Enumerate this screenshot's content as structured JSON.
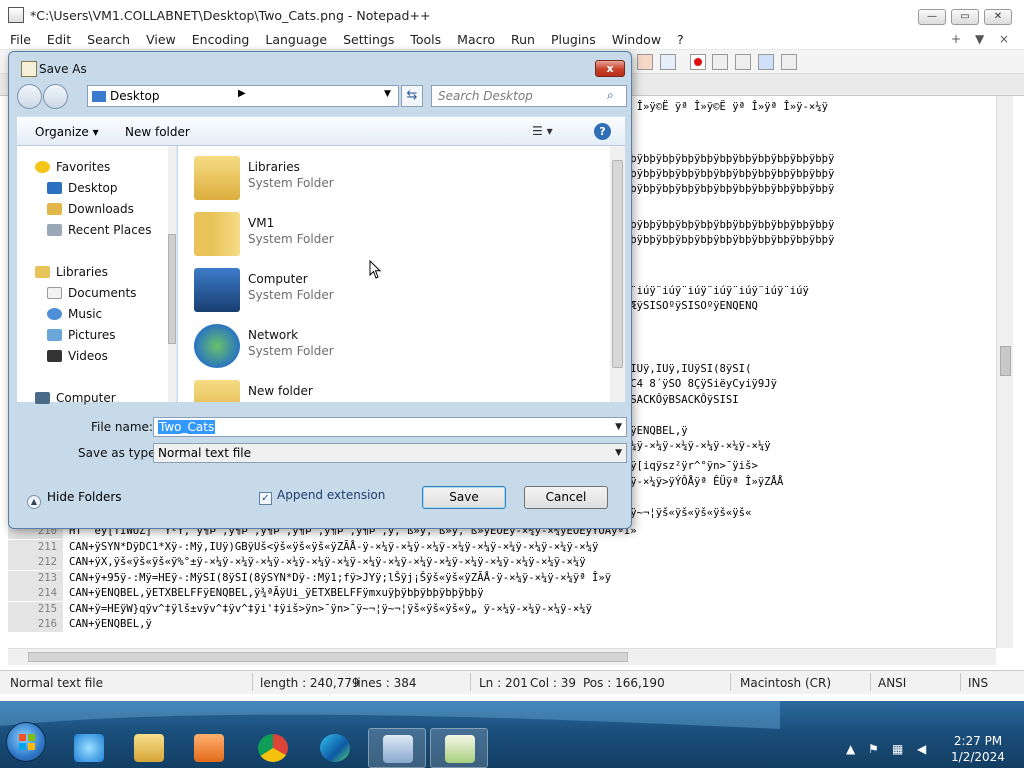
{
  "npp": {
    "title": "*C:\\Users\\VM1.COLLABNET\\Desktop\\Two_Cats.png - Notepad++",
    "menu": [
      "File",
      "Edit",
      "Search",
      "View",
      "Encoding",
      "Language",
      "Settings",
      "Tools",
      "Macro",
      "Run",
      "Plugins",
      "Window",
      "?"
    ],
    "menu_right": [
      "+",
      "▼",
      "×"
    ],
    "editor_lines": [
      {
        "num": "",
        "text": "                                                                ÿ©Ë ÿª Î»ÿ©Ë ÿª Î»ÿ©Ë ÿª Î»ÿ©Ë ÿª Î»ÿ©Ë ÿª Î»ÿª Î»ÿ-×¼ÿ"
      },
      {
        "num": "",
        "text": "                                                                þÿbþÿbþÿbþÿbþÿbþÿbþÿbþÿbþÿbþÿbþÿbþÿbþÿbþÿbþÿbþÿbþÿbþÿbþÿ"
      },
      {
        "num": "",
        "text": "                                                                þÿbþÿbþÿbþÿbþÿbþÿbþÿbþÿbþÿbþÿbþÿbþÿbþÿbþÿbþÿbþÿbþÿbþÿbþÿ"
      },
      {
        "num": "",
        "text": "                                                                þÿbþÿbþÿbþÿbþÿbþÿbþÿbþÿbþÿbþÿbþÿbþÿbþÿbþÿbþÿbþÿbþÿbþÿbþÿ"
      },
      {
        "num": "",
        "text": "                                                                þÿbþÿbþÿbþÿbþÿbþÿbþÿbþÿbþÿbþÿbþÿbþÿbþÿbþÿbþÿbþÿbþÿbþÿbþÿ"
      },
      {
        "num": "",
        "text": "                                                                þÿbþÿbþÿbþÿbþÿbþÿbþÿbþÿbþÿbþÿbþÿbþÿbþÿbþÿbþÿbþÿbþÿbþÿbþÿ"
      },
      {
        "num": "",
        "text": "                                                                ¨iúÿ¨iúÿ¨iúÿ¨iúÿ¨iúÿ¨iúÿ¨iúÿ¨iúÿ¨iúÿ¨iúÿ¨iúÿ¨iúÿ¨iúÿ"
      },
      {
        "num": "",
        "text": "                                                                Siëyj‡ÇÿyŒÔÿ\\yØÿKdÛÿETB,ÆÿSISOºÿSISOºÿENQENQ"
      },
      {
        "num": "",
        "text": "                                                                JYÿ=HEÿ-:Mÿ=HEÿ>JYÿ>JYÿ,IUÿ,IUÿ,IUÿSI(8ÿSI("
      },
      {
        "num": "",
        "text": "                                                                šÜÿ€šÜÿ€šÜÿ€šÜÿj…Üÿ>V¯ÿDC4 8´ÿSO 8ÇÿSiëyCyiÿ9Jÿ"
      },
      {
        "num": "",
        "text": "                                                                ëÿJ[åÿ/8iÿSISOºÿBSACKÔÿBSACKÔÿBSACKÔÿSISI"
      },
      {
        "num": "",
        "text": "                                                                þÿbþÿ1;fÿENQBEL,ÿENQBEL,ÿENQBEL,ÿ"
      },
      {
        "num": "",
        "text": "                                                                ÿ-×¼ÿ-×¼ÿ-×¼ÿª Î»ÿ-×¼ÿ-×¼ÿ-×¼ÿ-×¼ÿ-×¼ÿ-×¼ÿ-×¼ÿ"
      },
      {
        "num": "",
        "text": "                                                                ENQBEL,ÿSI(8ÿ-:Mÿ1;fÿGNpÿ[iqÿsz²ÿr^°ÿn>¯ÿiš>"
      },
      {
        "num": "",
        "text": "                                                                ÿ-×¼ÿ-×¼ÿ-×¼ÿ-×¼ÿ-×¼ÿ-×¼ÿ-×¼ÿ>ÿÝÔÅÿª ÊÜÿª Î»ÿZÅÅ"
      },
      {
        "num": "",
        "text": "                                                                ¥txŠÿ}%šÿiš>ÿn>¯ÿx™ÇÿUÝ±ÿ~¬¦ÿš«ÿš«ÿš«ÿš«ÿš«"
      },
      {
        "num": "210",
        "text": "HT  ëÿ[TIWUZ] ¨Ÿ²Ÿ, ÿ¶Þ ,ÿ¶Þ ,ÿ¶Þ ,ÿ¶Þ ,ÿ¶Þ ,ÿ¶Þ ,ÿ, ß»ÿ, ß»ÿ, ß»ÿÈÔÊÿ-×¼ÿ-×¼ÿÈÔÊÿÝÔÅÿªÎ»"
      },
      {
        "num": "211",
        "text": "CAN+ÿSYN*DÿDC1*Xÿ-:Mÿ,IUÿ)GBÿUš<ÿš«ÿš«ÿš«ÿZÃÅ-ÿ-×¼ÿ-×¼ÿ-×¼ÿ-×¼ÿ-×¼ÿ-×¼ÿ-×¼ÿ-×¼ÿ-×¼ÿ"
      },
      {
        "num": "212",
        "text": "CAN+ÿX,ÿš«ÿš«ÿš«ÿ%°±ÿ-×¼ÿ-×¼ÿ-×¼ÿ-×¼ÿ-×¼ÿ-×¼ÿ-×¼ÿ-×¼ÿ-×¼ÿ-×¼ÿ-×¼ÿ-×¼ÿ-×¼ÿ-×¼ÿ-×¼ÿ"
      },
      {
        "num": "213",
        "text": "CAN+ÿ+95ÿ-:Mÿ=HEÿ-:MÿSI(8ÿSI(8ÿSYN*Dÿ-:Mÿ1;fÿ>JYÿ;lŠÿj¡Šÿš«ÿš«ÿZÃÅ-ÿ-×¼ÿ-×¼ÿ-×¼ÿª Î»ÿ"
      },
      {
        "num": "214",
        "text": "CAN+ÿENQBEL,ÿETXBELFFÿENQBEL,ÿ¾ªÃÿUi_ÿETXBELFFÿmxuÿþÿbþÿbþÿbþÿbþÿ"
      },
      {
        "num": "215",
        "text": "CAN+ÿ=HEÿW}qÿv^‡ÿlš±vÿv^‡ÿv^‡ÿi'‡ÿiš>ÿn>¯ÿn>¯ÿ~¬¦ÿ~¬¦ÿš«ÿš«ÿš«ÿ„ ÿ-×¼ÿ-×¼ÿ-×¼ÿ-×¼ÿ"
      },
      {
        "num": "216",
        "text": "CAN+ÿENQBEL,ÿ"
      }
    ],
    "status": {
      "type": "Normal text file",
      "length": "length : 240,779",
      "lines": "lines : 384",
      "ln": "Ln : 201",
      "col": "Col : 39",
      "pos": "Pos : 166,190",
      "eol": "Macintosh (CR)",
      "encoding": "ANSI",
      "ins": "INS"
    }
  },
  "dialog": {
    "title": "Save As",
    "close_label": "x",
    "address": "Desktop",
    "search_placeholder": "Search Desktop",
    "organize_label": "Organize ▾",
    "new_folder_label": "New folder",
    "nav": {
      "favorites": "Favorites",
      "desktop": "Desktop",
      "downloads": "Downloads",
      "recent": "Recent Places",
      "libraries": "Libraries",
      "documents": "Documents",
      "music": "Music",
      "pictures": "Pictures",
      "videos": "Videos",
      "computer": "Computer"
    },
    "files": [
      {
        "name": "Libraries",
        "type": "System Folder"
      },
      {
        "name": "VM1",
        "type": "System Folder"
      },
      {
        "name": "Computer",
        "type": "System Folder"
      },
      {
        "name": "Network",
        "type": "System Folder"
      },
      {
        "name": "New folder",
        "type": ""
      }
    ],
    "file_name_label": "File name:",
    "file_name_value": "Two_Cats",
    "save_type_label": "Save as type:",
    "save_type_value": "Normal text file",
    "hide_folders_label": "Hide Folders",
    "append_extension_label": "Append extension",
    "save_label": "Save",
    "cancel_label": "Cancel"
  },
  "taskbar": {
    "time": "2:27 PM",
    "date": "1/2/2024"
  }
}
